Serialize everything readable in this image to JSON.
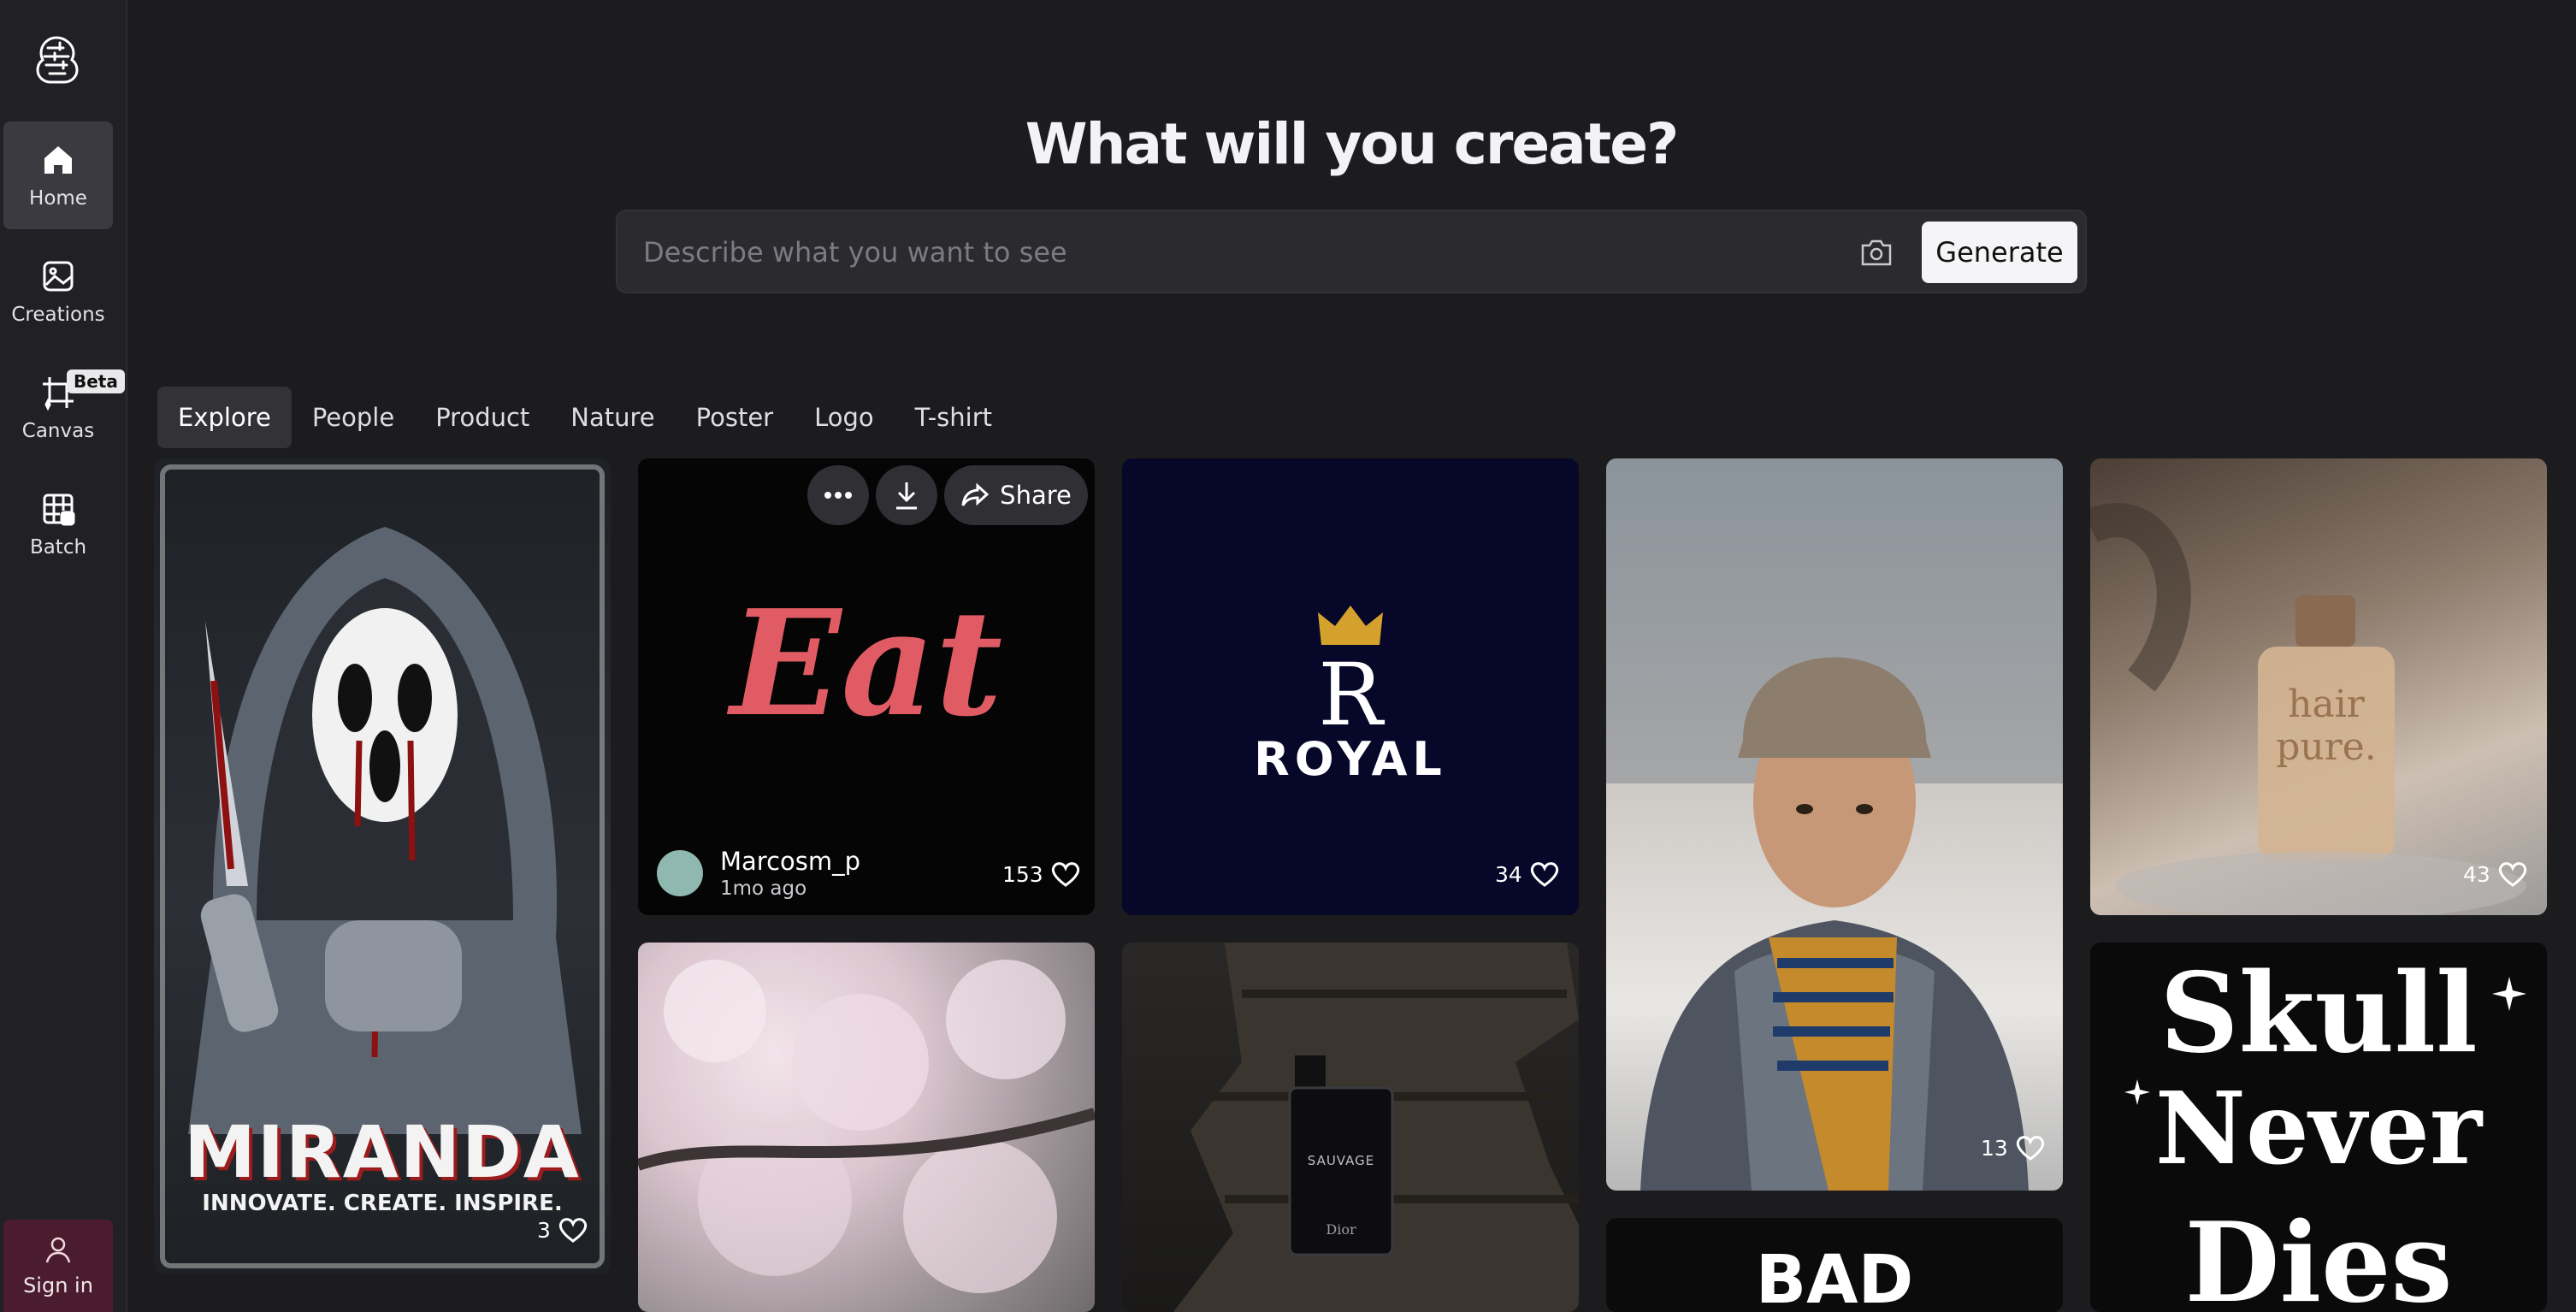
{
  "sidebar": {
    "nav": [
      {
        "label": "Home",
        "icon": "home-icon",
        "active": true
      },
      {
        "label": "Creations",
        "icon": "image-icon"
      },
      {
        "label": "Canvas",
        "icon": "crop-sparkle-icon",
        "badge": "Beta"
      },
      {
        "label": "Batch",
        "icon": "grid-image-icon"
      }
    ],
    "signin_label": "Sign in"
  },
  "header": {
    "headline": "What will you create?",
    "search_placeholder": "Describe what you want to see",
    "generate_label": "Generate"
  },
  "tabs": [
    "Explore",
    "People",
    "Product",
    "Nature",
    "Poster",
    "Logo",
    "T-shirt"
  ],
  "cards": [
    {
      "subject": "Ghostface poster",
      "poster_title": "MIRANDA",
      "poster_tagline": "INNOVATE. CREATE. INSPIRE.",
      "likes": "3"
    },
    {
      "subject": "Eat logo",
      "logo_text": "Eat",
      "author": "Marcosm_p",
      "time": "1mo ago",
      "likes": "153",
      "share_label": "Share"
    },
    {
      "subject": "Royal logo",
      "logo_text": "ROYAL",
      "likes": "34"
    },
    {
      "subject": "Young man in beanie",
      "likes": "13"
    },
    {
      "subject": "hair pure bottle",
      "label_line1": "hair",
      "label_line2": "pure.",
      "likes": "43"
    },
    {
      "subject": "Cherry blossoms"
    },
    {
      "subject": "Sauvage perfume on wood",
      "bottle_label": "SAUVAGE",
      "bottle_brand": "Dior"
    },
    {
      "subject": "BAD poster",
      "text": "BAD"
    },
    {
      "subject": "Skull Never Dies lettering",
      "line1": "Skull",
      "line2": "Never",
      "line3": "Dies"
    }
  ],
  "colors": {
    "background": "#1c1c1f",
    "sidebar": "#212125",
    "signin": "#4a1c2e",
    "eat_logo": "#e05b63",
    "royal_bg": "#07072a",
    "royal_crown": "#d4a22c"
  }
}
